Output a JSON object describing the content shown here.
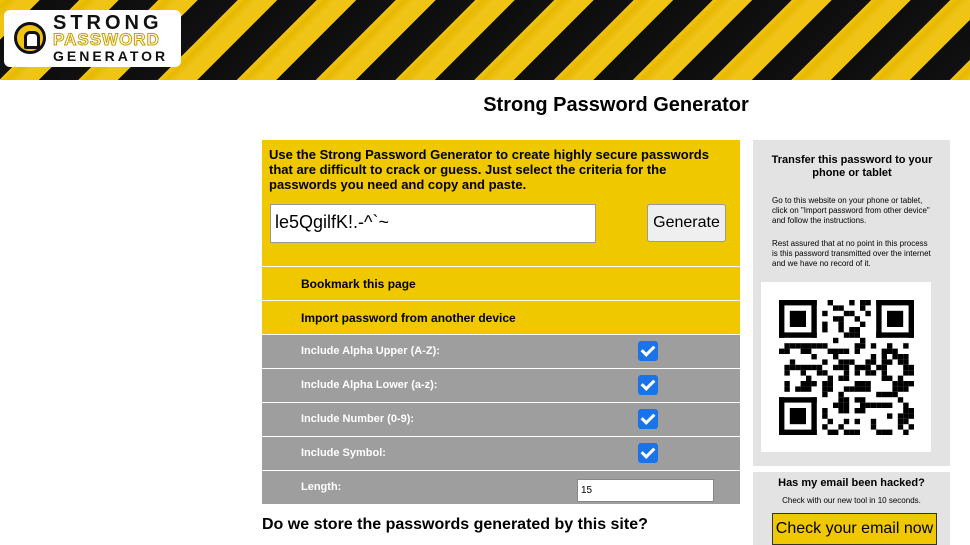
{
  "logo": {
    "line1": "STRONG",
    "line2": "PASSWORD",
    "line3": "GENERATOR"
  },
  "page": {
    "title": "Strong Password Generator"
  },
  "generator": {
    "intro": "Use the Strong Password Generator to create highly secure passwords that are difficult to crack or guess. Just select the criteria for the passwords you need and copy and paste.",
    "password_value": "le5QgilfK!.-^`~",
    "generate_label": "Generate",
    "bookmark_label": "Bookmark this page",
    "import_label": "Import password from another device",
    "options": [
      {
        "label": "Include Alpha Upper (A-Z):",
        "checked": true
      },
      {
        "label": "Include Alpha Lower (a-z):",
        "checked": true
      },
      {
        "label": "Include Number (0-9):",
        "checked": true
      },
      {
        "label": "Include Symbol:",
        "checked": true
      }
    ],
    "length_label": "Length:",
    "length_value": "15"
  },
  "faq": {
    "question": "Do we store the passwords generated by this site?"
  },
  "transfer": {
    "title": "Transfer this password to your phone or tablet",
    "instructions": "Go to this website on your phone or tablet, click on \"Import password from other device\" and follow the instructions.",
    "assurance": "Rest assured that at no point in this process is this password transmitted over the internet and we have no record of it."
  },
  "email_check": {
    "title": "Has my email been hacked?",
    "text": "Check with our new tool in 10 seconds.",
    "button_label": "Check your email now"
  },
  "colors": {
    "accent_yellow": "#f0c800",
    "option_gray": "#9e9e9e",
    "checkbox_blue": "#1a73e8",
    "side_gray": "#e3e3e3"
  }
}
